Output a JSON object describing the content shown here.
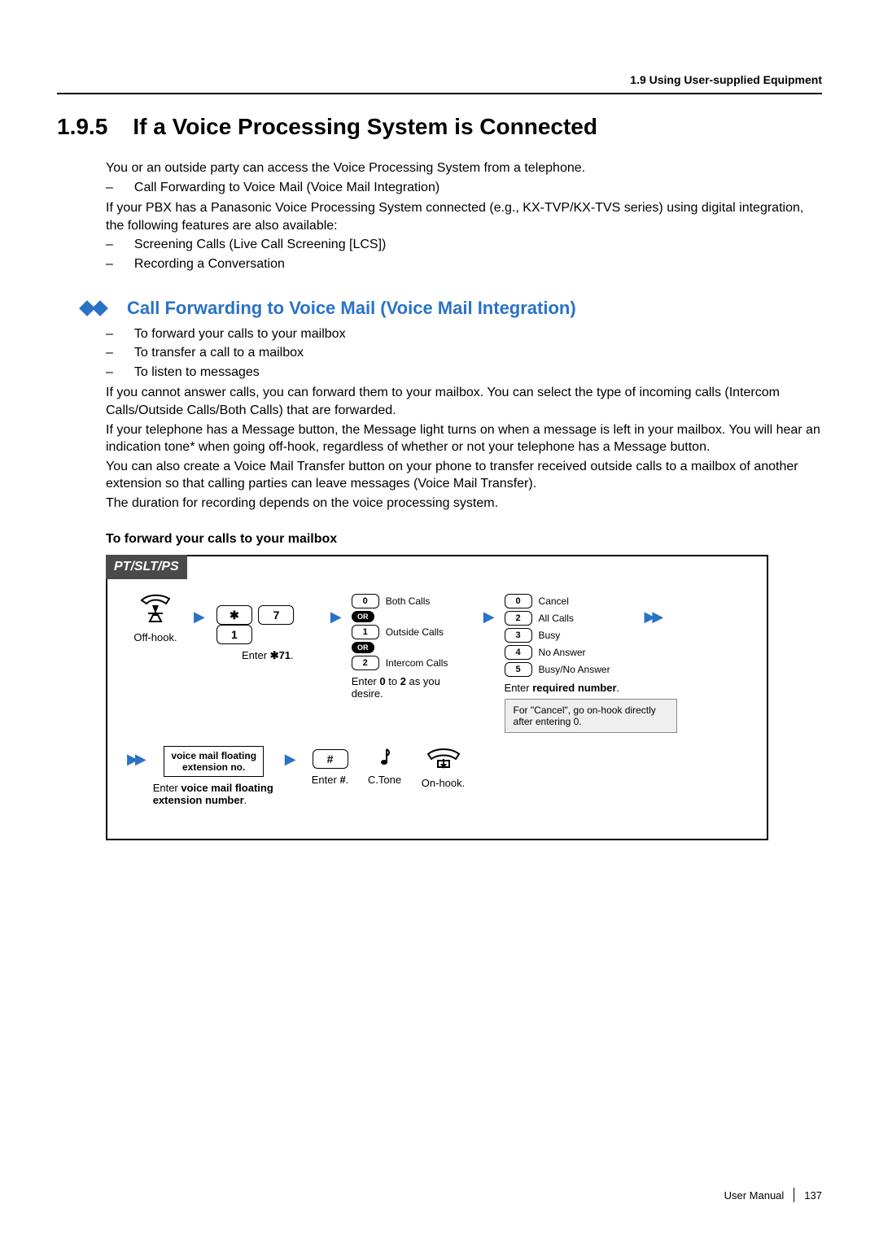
{
  "header": {
    "section": "1.9 Using User-supplied Equipment"
  },
  "title": {
    "num": "1.9.5",
    "text": "If a Voice Processing System is Connected"
  },
  "intro": {
    "p1": "You or an outside party can access the Voice Processing System from a telephone.",
    "b1": "Call Forwarding to Voice Mail (Voice Mail Integration)",
    "p2": "If your PBX has a Panasonic Voice Processing System connected (e.g., KX-TVP/KX-TVS series) using digital integration, the following features are also available:",
    "b2": "Screening Calls (Live Call Screening [LCS])",
    "b3": "Recording a Conversation"
  },
  "subheading": "Call Forwarding to Voice Mail (Voice Mail Integration)",
  "sub_bullets": {
    "b1": "To forward your calls to your mailbox",
    "b2": "To transfer a call to a mailbox",
    "b3": "To listen to messages"
  },
  "para": {
    "p1": "If you cannot answer calls, you can forward them to your mailbox. You can select the type of incoming calls (Intercom Calls/Outside Calls/Both Calls) that are forwarded.",
    "p2": "If your telephone has a Message button, the Message light turns on when a message is left in your mailbox. You will hear an indication tone* when going off-hook, regardless of whether or not your telephone has a Message button.",
    "p3": "You can also create a Voice Mail Transfer button on your phone to transfer received outside calls to a mailbox of another extension so that calling parties can leave messages (Voice Mail Transfer).",
    "p4": "The duration for recording depends on the voice processing system."
  },
  "instr_title": "To forward your calls to your mailbox",
  "flow": {
    "header": "PT/SLT/PS",
    "offhook": "Off-hook.",
    "keys": {
      "star": "✱",
      "k7": "7",
      "k1": "1"
    },
    "enter71_a": "Enter ",
    "enter71_b": "✱71",
    "enter71_c": ".",
    "opts1": {
      "k0": "0",
      "l0": "Both Calls",
      "or": "OR",
      "k1": "1",
      "l1": "Outside Calls",
      "k2": "2",
      "l2": "Intercom Calls"
    },
    "cap1_a": "Enter ",
    "cap1_b": "0",
    "cap1_c": " to ",
    "cap1_d": "2",
    "cap1_e": " as you desire.",
    "opts2": {
      "k0": "0",
      "l0": "Cancel",
      "k2": "2",
      "l2": "All Calls",
      "k3": "3",
      "l3": "Busy",
      "k4": "4",
      "l4": "No Answer",
      "k5": "5",
      "l5": "Busy/No Answer"
    },
    "cap2_a": "Enter ",
    "cap2_b": "required number",
    "cap2_c": ".",
    "note": "For \"Cancel\", go on-hook directly after entering 0.",
    "vm_box_l1": "voice mail floating",
    "vm_box_l2": "extension no.",
    "cap3_a": "Enter ",
    "cap3_b": "voice mail floating extension number",
    "cap3_c": ".",
    "hash": "#",
    "cap4_a": "Enter ",
    "cap4_b": "#",
    "cap4_c": ".",
    "ctone": "C.Tone",
    "onhook": "On-hook."
  },
  "footer": {
    "manual": "User Manual",
    "page": "137"
  }
}
